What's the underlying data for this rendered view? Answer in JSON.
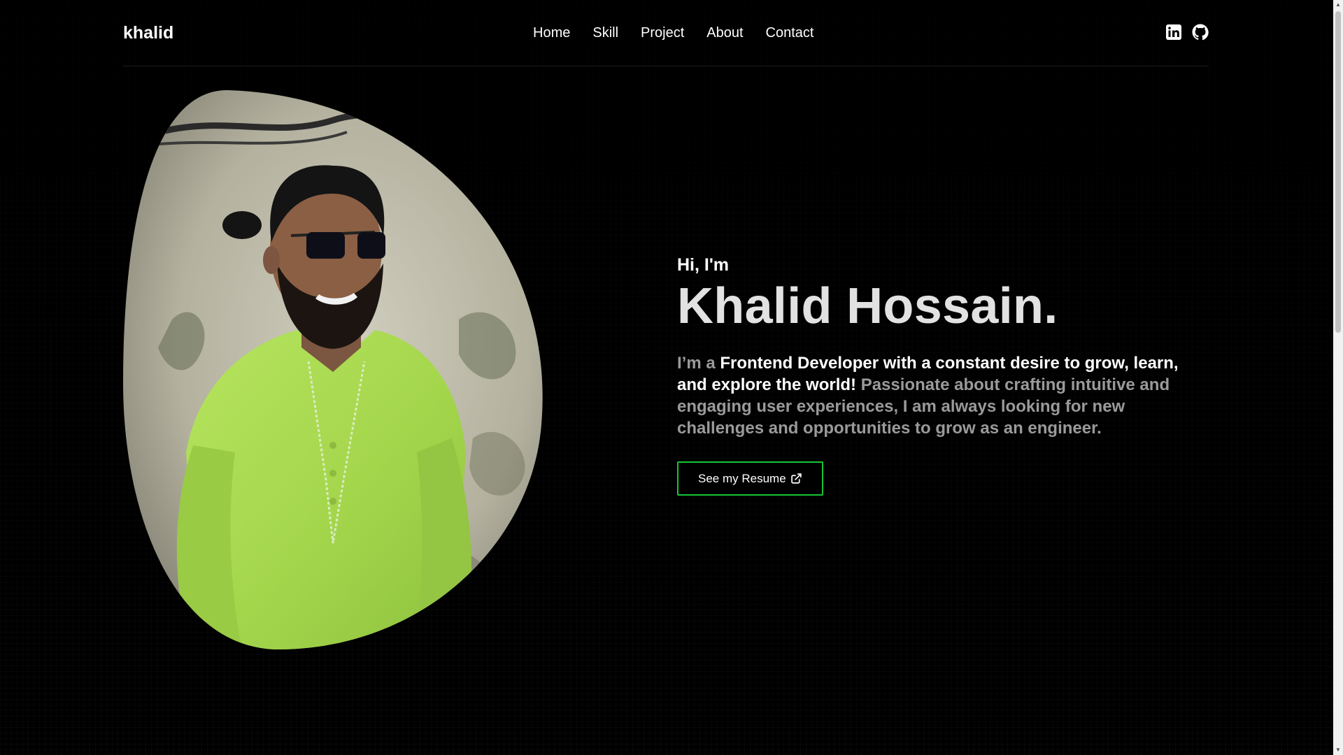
{
  "nav": {
    "brand": "khalid",
    "links": [
      "Home",
      "Skill",
      "Project",
      "About",
      "Contact"
    ],
    "social_icons": [
      "linkedin-icon",
      "github-icon"
    ]
  },
  "hero": {
    "greeting": "Hi, I'm",
    "name": "Khalid Hossain.",
    "intro_prefix": "I’m a ",
    "intro_highlight": "Frontend Developer with a constant desire to grow, learn, and explore the world!",
    "intro_suffix": " Passionate about crafting intuitive and engaging user experiences, I am always looking for new challenges and opportunities to grow as an engineer.",
    "resume_label": "See my Resume",
    "resume_icon": "external-link-icon",
    "photo_icon": "portrait-photo"
  },
  "colors": {
    "background": "#000000",
    "accent_border": "#16c535",
    "name_text": "#e2e2e2",
    "muted_text": "#9a9a9a",
    "shirt": "#a9dc52"
  }
}
